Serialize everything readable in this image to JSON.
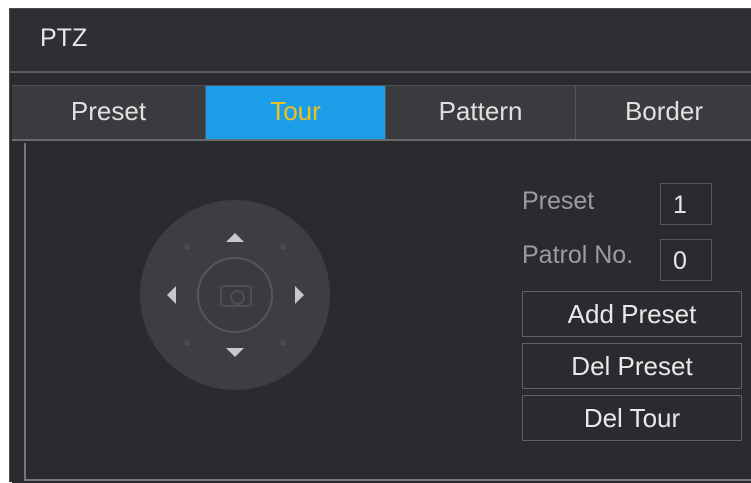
{
  "window": {
    "title": "PTZ"
  },
  "tabs": [
    {
      "label": "Preset",
      "active": false
    },
    {
      "label": "Tour",
      "active": true
    },
    {
      "label": "Pattern",
      "active": false
    },
    {
      "label": "Border",
      "active": false
    }
  ],
  "form": {
    "preset_label": "Preset",
    "preset_value": "1",
    "patrol_label": "Patrol No.",
    "patrol_value": "0"
  },
  "buttons": {
    "add_preset": "Add Preset",
    "del_preset": "Del Preset",
    "del_tour": "Del Tour"
  },
  "colors": {
    "active_tab_bg": "#1d9ee8",
    "active_tab_text": "#f0c020",
    "panel_bg": "#2a2b2f"
  }
}
